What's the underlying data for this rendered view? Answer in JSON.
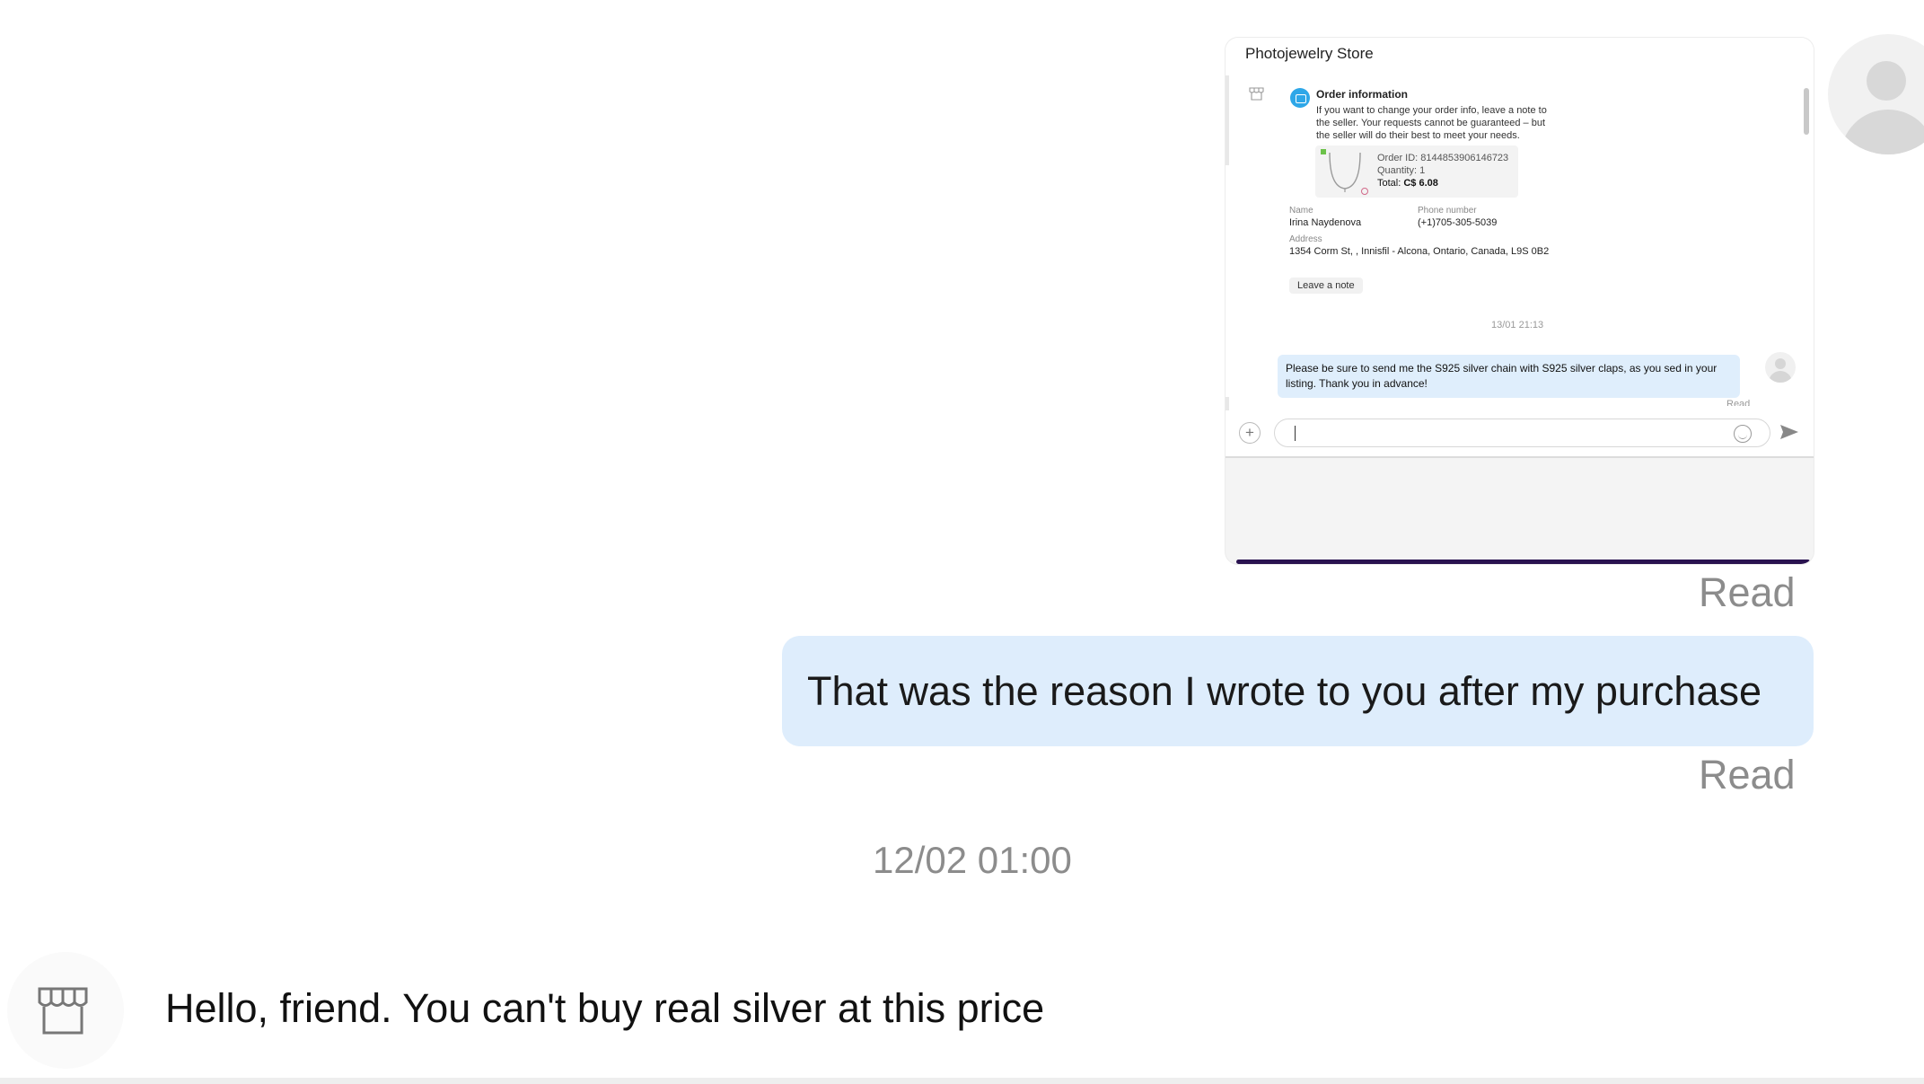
{
  "screenshot": {
    "title": "Photojewelry Store",
    "order_info_title": "Order information",
    "order_info_text": "If you want to change your order info, leave a note to the seller. Your requests cannot be guaranteed – but the seller will do their best to meet your needs.",
    "order_id": "Order ID: 8144853906146723",
    "quantity": "Quantity: 1",
    "total_label": "Total: ",
    "total_value": "C$ 6.08",
    "name_label": "Name",
    "name_value": "Irina Naydenova",
    "phone_label": "Phone number",
    "phone_value": "(+1)705-305-5039",
    "address_label": "Address",
    "address_value": "1354 Corm St, , Innisfil - Alcona, Ontario, Canada, L9S 0B2",
    "leave_note": "Leave a note",
    "date": "13/01 21:13",
    "message": "Please be sure to send me the S925 silver chain with S925 silver claps, as you sed in your listing. Thank you in advance!",
    "read": "Read"
  },
  "messages": {
    "read_1": "Read",
    "outgoing_text": "That was the reason I wrote to you after my purchase",
    "read_2": "Read",
    "date_separator": "12/02 01:00",
    "incoming_text": "Hello, friend. You can't buy real silver at this price"
  },
  "icons": {
    "user_avatar": "user-avatar-icon",
    "store": "store-icon",
    "info": "info-icon",
    "plus": "plus-icon",
    "emoji": "emoji-icon",
    "send": "send-icon"
  },
  "colors": {
    "outgoing_bubble": "#deedfc",
    "muted_text": "#8c8c8c",
    "info_blue": "#2ea7e8"
  }
}
